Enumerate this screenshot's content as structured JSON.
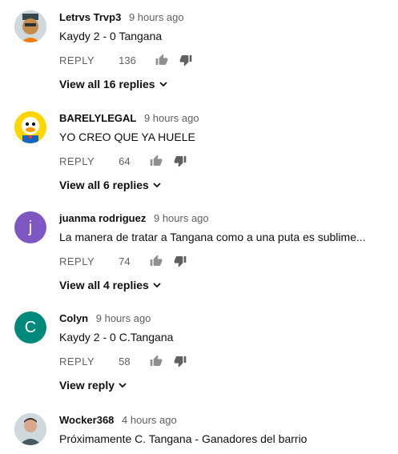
{
  "comments": [
    {
      "author": "Letrvs Trvp3",
      "time": "9 hours ago",
      "text": "Kaydy 2 - 0 Tangana",
      "reply_label": "REPLY",
      "likes": "136",
      "view_replies": "View all 16 replies",
      "avatar": {
        "kind": "illustration",
        "icon": "cartoon-character-avatar"
      }
    },
    {
      "author": "BARELYLEGAL",
      "time": "9 hours ago",
      "text": "YO CREO QUE YA HUELE",
      "reply_label": "REPLY",
      "likes": "64",
      "view_replies": "View all 6 replies",
      "avatar": {
        "kind": "illustration",
        "icon": "cartoon-duck-avatar"
      }
    },
    {
      "author": "juanma rodriguez",
      "time": "9 hours ago",
      "text": "La manera de tratar a Tangana como a una puta es sublime...",
      "reply_label": "REPLY",
      "likes": "74",
      "view_replies": "View all 4 replies",
      "avatar": {
        "kind": "letter",
        "letter": "j",
        "color": "#7e57c2"
      }
    },
    {
      "author": "Colyn",
      "time": "9 hours ago",
      "text": "Kaydy 2 - 0 C.Tangana",
      "reply_label": "REPLY",
      "likes": "58",
      "view_replies": "View reply",
      "avatar": {
        "kind": "letter",
        "letter": "C",
        "color": "#00897b"
      }
    },
    {
      "author": "Wocker368",
      "time": "4 hours ago",
      "text": "Próximamente C. Tangana - Ganadores del barrio",
      "avatar": {
        "kind": "photo",
        "icon": "person-photo-avatar"
      }
    }
  ]
}
